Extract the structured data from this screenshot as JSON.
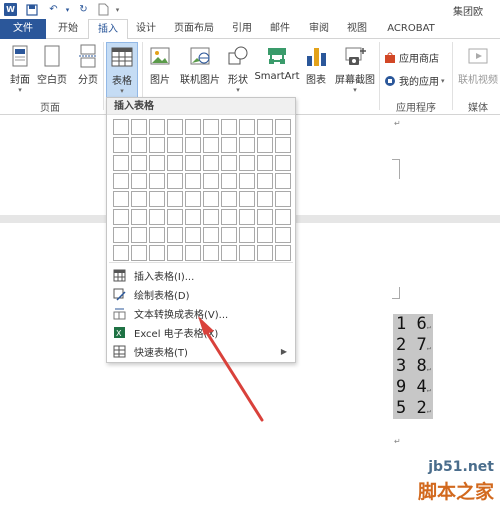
{
  "window": {
    "title": "集团欧"
  },
  "quick_access": {
    "word_logo": "W"
  },
  "tabs": [
    "文件",
    "开始",
    "插入",
    "设计",
    "页面布局",
    "引用",
    "邮件",
    "审阅",
    "视图",
    "ACROBAT"
  ],
  "active_tab": "插入",
  "ribbon": {
    "pages": {
      "cover": "封面",
      "blank": "空白页",
      "break": "分页",
      "group": "页面"
    },
    "table": {
      "label": "表格"
    },
    "illustrations": {
      "picture": "图片",
      "online_picture": "联机图片",
      "shapes": "形状",
      "smartart": "SmartArt",
      "chart": "图表",
      "screenshot": "屏幕截图"
    },
    "apps": {
      "store": "应用商店",
      "my_apps": "我的应用",
      "group": "应用程序"
    },
    "media": {
      "online_video": "联机视频",
      "group": "媒体"
    }
  },
  "table_menu": {
    "title": "插入表格",
    "grid_cols": 10,
    "grid_rows": 8,
    "items": [
      {
        "label": "插入表格(I)...",
        "icon": "insert-table-icon"
      },
      {
        "label": "绘制表格(D)",
        "icon": "draw-table-icon"
      },
      {
        "label": "文本转换成表格(V)...",
        "icon": "text-to-table-icon"
      },
      {
        "label": "Excel 电子表格(X)",
        "icon": "excel-icon"
      },
      {
        "label": "快速表格(T)",
        "icon": "quick-table-icon"
      }
    ]
  },
  "document": {
    "selected_text": [
      {
        "a": "1",
        "b": "6"
      },
      {
        "a": "2",
        "b": "7"
      },
      {
        "a": "3",
        "b": "8"
      },
      {
        "a": "9",
        "b": "4"
      },
      {
        "a": "5",
        "b": "2"
      }
    ]
  },
  "watermark": {
    "url": "jb51.net",
    "name": "脚本之家"
  },
  "colors": {
    "word_blue": "#2b579a",
    "arrow_red": "#d9413b",
    "selection": "#c7c7c7"
  }
}
